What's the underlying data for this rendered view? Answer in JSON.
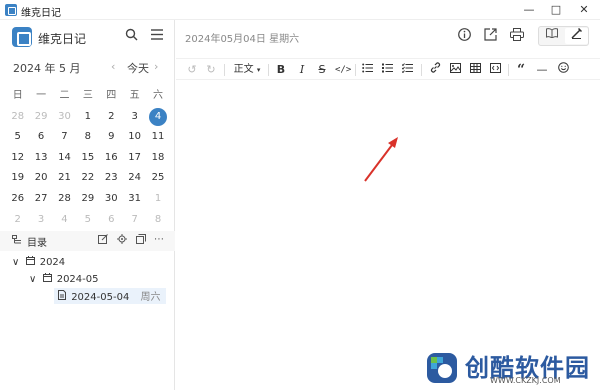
{
  "window": {
    "title": "维克日记",
    "minimize_icon": "minimize-icon",
    "maximize_icon": "maximize-icon",
    "close_icon": "close-icon"
  },
  "sidebar": {
    "app_name": "维克日记",
    "month_title": "2024 年 5 月",
    "prev_icon": "‹",
    "next_icon": "›",
    "today_label": "今天",
    "weekdays": [
      "日",
      "一",
      "二",
      "三",
      "四",
      "五",
      "六"
    ],
    "calendar": [
      [
        "28",
        "29",
        "30",
        "1",
        "2",
        "3",
        "4"
      ],
      [
        "5",
        "6",
        "7",
        "8",
        "9",
        "10",
        "11"
      ],
      [
        "12",
        "13",
        "14",
        "15",
        "16",
        "17",
        "18"
      ],
      [
        "19",
        "20",
        "21",
        "22",
        "23",
        "24",
        "25"
      ],
      [
        "26",
        "27",
        "28",
        "29",
        "30",
        "31",
        "1"
      ],
      [
        "2",
        "3",
        "4",
        "5",
        "6",
        "7",
        "8"
      ]
    ],
    "selected_day": "4",
    "toc_label": "目录",
    "tree": {
      "year": "2024",
      "month": "2024-05",
      "entry_date": "2024-05-04",
      "entry_weekday": "周六"
    }
  },
  "main": {
    "date_header": "2024年05月04日 星期六",
    "paragraph_style": "正文"
  },
  "watermark": {
    "text": "创酷软件园",
    "url": "WWW.CKZKJ.COM"
  },
  "colors": {
    "accent": "#3b82c4",
    "arrow": "#d9322a"
  }
}
